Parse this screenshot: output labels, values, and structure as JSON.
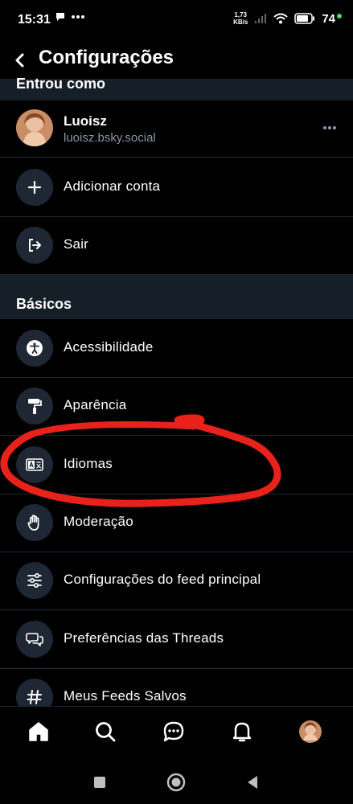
{
  "status": {
    "time": "15:31",
    "speed_value": "1,73",
    "speed_unit": "KB/s",
    "battery": "74"
  },
  "header": {
    "title": "Configurações"
  },
  "sections": {
    "account_header": "Entrou como",
    "basics_header": "Básicos"
  },
  "account": {
    "name": "Luoisz",
    "handle": "luoisz.bsky.social"
  },
  "account_actions": [
    {
      "label": "Adicionar conta",
      "icon": "plus-icon"
    },
    {
      "label": "Sair",
      "icon": "sign-out-icon"
    }
  ],
  "basics_items": [
    {
      "label": "Acessibilidade",
      "icon": "accessibility-icon"
    },
    {
      "label": "Aparência",
      "icon": "paint-roller-icon"
    },
    {
      "label": "Idiomas",
      "icon": "language-icon"
    },
    {
      "label": "Moderação",
      "icon": "hand-icon"
    },
    {
      "label": "Configurações do feed principal",
      "icon": "sliders-icon"
    },
    {
      "label": "Preferências das Threads",
      "icon": "chat-bubbles-icon"
    },
    {
      "label": "Meus Feeds Salvos",
      "icon": "hashtag-icon"
    }
  ],
  "colors": {
    "background": "#000000",
    "section_background": "#161e27",
    "icon_circle": "#1e2733",
    "secondary_text": "#8b98a8",
    "annotation_red": "#e8221a"
  }
}
